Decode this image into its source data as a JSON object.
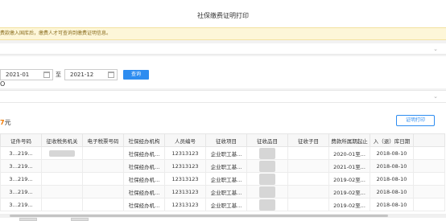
{
  "title": "社保缴费证明打印",
  "notice": "费款缴入国库后，缴费人才可查询到缴费证明信息。",
  "filter": {
    "start_date": "2021-01",
    "separator": "至",
    "end_date": "2021-12",
    "query_label": "查询",
    "edge_char": "O"
  },
  "result": {
    "amount_digit": "7",
    "amount_unit": "元",
    "print_label": "证明打印"
  },
  "table": {
    "headers": [
      "证件号码",
      "征收税务机关",
      "电子税票号码",
      "社保经办机构",
      "人员编号",
      "征收项目",
      "征收品目",
      "征收子目",
      "费款所属期起止",
      "入（退）库日期"
    ],
    "rows": [
      {
        "id": "3…219...",
        "agency": "社保经办机...",
        "person": "12313123",
        "item": "企业职工基...",
        "period": "2020-01至...",
        "date": "2018-08-10"
      },
      {
        "id": "3…219...",
        "agency": "社保经办机...",
        "person": "12313123",
        "item": "企业职工基...",
        "period": "2021-01至...",
        "date": "2018-08-10"
      },
      {
        "id": "3…219...",
        "agency": "社保经办机...",
        "person": "12313123",
        "item": "企业职工基...",
        "period": "2019-02至...",
        "date": "2018-08-10"
      },
      {
        "id": "3…219...",
        "agency": "社保经办机...",
        "person": "12313123",
        "item": "企业职工基...",
        "period": "2019-02至...",
        "date": "2018-08-10"
      },
      {
        "id": "3…219...",
        "agency": "社保经办机...",
        "person": "12313123",
        "item": "企业职工基...",
        "period": "2019-02至...",
        "date": "2018-08-10"
      }
    ]
  },
  "icons": {
    "chevron": "chevron-down-icon",
    "calendar": "calendar-icon"
  }
}
